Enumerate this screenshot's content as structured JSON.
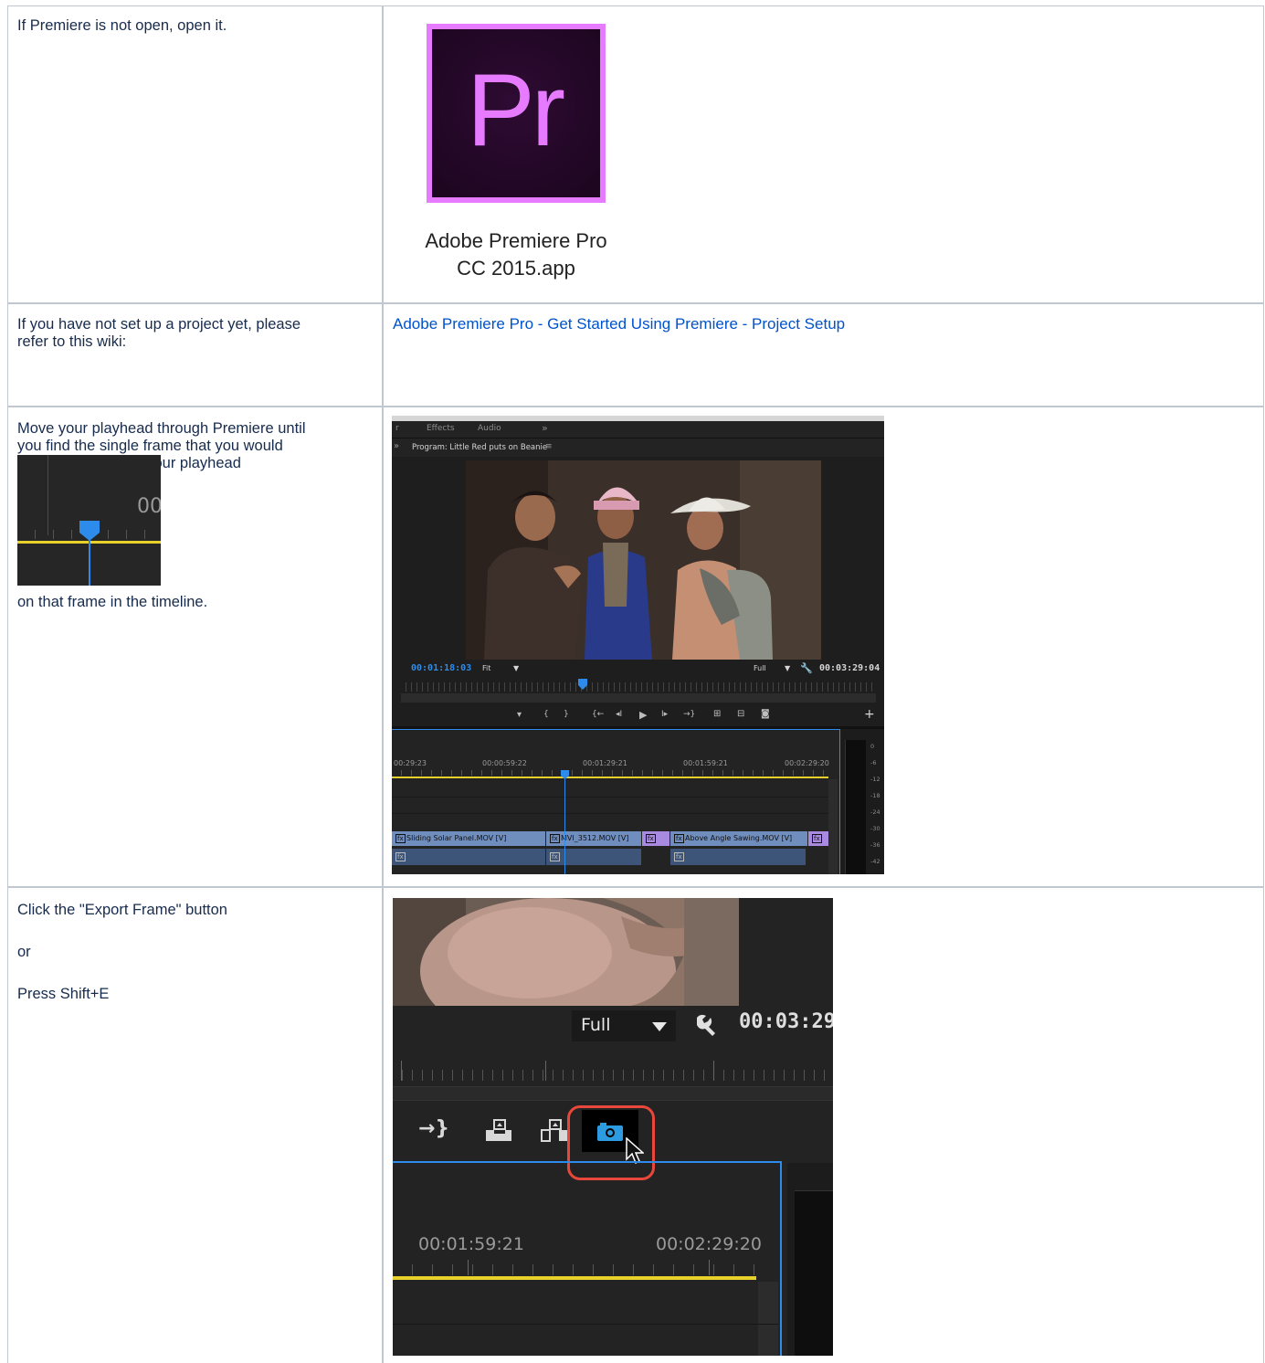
{
  "row1": {
    "instruction": "If Premiere is not open, open it.",
    "app_icon_letters": "Pr",
    "app_name_line1": "Adobe Premiere Pro",
    "app_name_line2": "CC 2015.app"
  },
  "row2": {
    "instruction_line1": "If you have not set up a project yet, please",
    "instruction_line2": "refer to this wiki:",
    "link_text": "Adobe Premiere Pro - Get Started Using Premiere - Project Setup"
  },
  "row3": {
    "instruction_line1": "Move your playhead through Premiere until",
    "instruction_line2": "you find the single frame that you would",
    "instruction_line3": "like to export.  Park your playhead",
    "instruction_after": "on that frame in the timeline.",
    "playhead_thumb_timecode": "00",
    "panel_tabs": [
      "r",
      "Effects",
      "Audio",
      "»"
    ],
    "program_title": "Program: Little Red puts on Beanie",
    "program_menu_glyph": "≡",
    "left_chevron": "»",
    "current_timecode": "00:01:18:03",
    "fit_label": "Fit",
    "full_label": "Full",
    "duration_timecode": "00:03:29:04",
    "add_glyph": "+",
    "transport_glyphs": [
      "▾",
      "{",
      "}",
      "{←",
      "◂I",
      "▶",
      "I▸",
      "→}",
      "⊞",
      "⊟",
      "◙"
    ],
    "timeline_ticks": [
      "00:29:23",
      "00:00:59:22",
      "00:01:29:21",
      "00:01:59:21",
      "00:02:29:20"
    ],
    "clips": [
      "Sliding Solar Panel.MOV [V]",
      "MVI_3512.MOV [V]",
      "Above Angle Sawing.MOV [V]"
    ],
    "clip_badge": "fx",
    "meter_labels": [
      "0",
      "-6",
      "-12",
      "-18",
      "-24",
      "-30",
      "-36",
      "-42"
    ]
  },
  "row4": {
    "instruction": "Click the \"Export Frame\" button",
    "or_text": "or",
    "shortcut_text": "Press Shift+E",
    "full_label": "Full",
    "timecode": "00:03:29",
    "tick1": "00:01:59:21",
    "tick2": "00:02:29:20"
  },
  "colors": {
    "link": "#0052cc",
    "premiere_purple": "#e77bff",
    "premiere_bg": "#2a0b2f",
    "playhead_blue": "#2d8ceb",
    "highlight_red": "#e8473b",
    "timeline_yellow": "#e7d12a",
    "video_clip_blue": "#6f8dbd",
    "video_clip_purple": "#a88ae0"
  },
  "icons": {
    "app_icon": "premiere-pro-app-icon",
    "export_frame": "camera-icon",
    "settings": "wrench-icon",
    "cursor": "mouse-pointer-icon"
  }
}
